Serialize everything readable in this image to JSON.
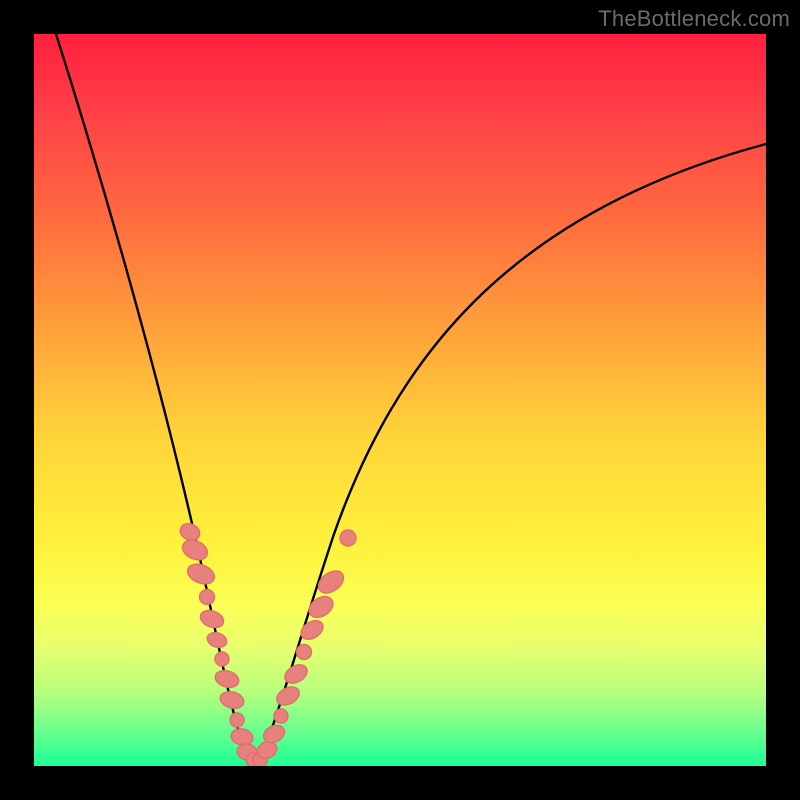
{
  "watermark": "TheBottleneck.com",
  "colors": {
    "background": "#000000",
    "curve": "#000000",
    "markerFill": "#e8807e",
    "markerStroke": "#de6f6d",
    "gradient": [
      "#ff1f3e",
      "#ff3e47",
      "#ff6a3f",
      "#ffa03a",
      "#ffd43a",
      "#fff23b",
      "#fbff56",
      "#e6ff6e",
      "#b6ff7d",
      "#6cff8c",
      "#1bff96"
    ]
  },
  "chart_data": {
    "type": "line",
    "title": "",
    "xlabel": "",
    "ylabel": "",
    "xlim": [
      0,
      100
    ],
    "ylim": [
      0,
      100
    ],
    "grid": false,
    "legend": false,
    "annotations": [
      "TheBottleneck.com"
    ],
    "series": [
      {
        "name": "bottleneck-curve",
        "x": [
          3,
          5,
          8,
          11,
          14,
          17,
          20,
          22,
          24,
          26,
          28,
          30,
          32,
          35,
          40,
          45,
          50,
          55,
          60,
          68,
          76,
          84,
          92,
          100
        ],
        "y": [
          100,
          90,
          78,
          66,
          55,
          44,
          33,
          23,
          15,
          8,
          3,
          0,
          2,
          9,
          22,
          34,
          44,
          52,
          58,
          66,
          72,
          77,
          81,
          85
        ]
      },
      {
        "name": "marker-cluster",
        "x": [
          20.5,
          21.5,
          22.5,
          23.5,
          24.3,
          25.0,
          25.8,
          26.5,
          27.2,
          27.8,
          28.4,
          29.0,
          29.6,
          30.2,
          30.8,
          31.4,
          32.0,
          32.6,
          33.2,
          33.8,
          34.4,
          35.2,
          36.4,
          38.4
        ],
        "y": [
          32,
          28,
          24,
          20,
          16,
          12,
          9,
          6,
          4,
          2,
          1,
          0,
          0.5,
          1.5,
          3,
          5,
          7,
          9.5,
          12,
          15,
          18,
          21,
          25,
          33
        ]
      }
    ]
  }
}
